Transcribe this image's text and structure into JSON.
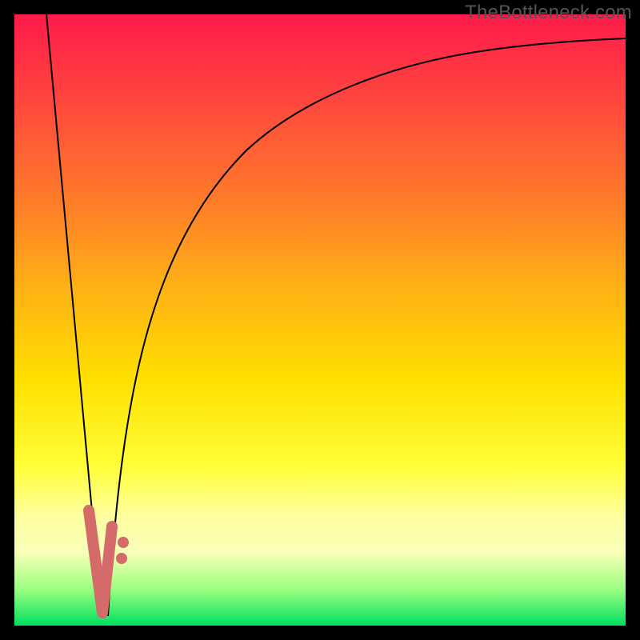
{
  "watermark": "TheBottleneck.com",
  "colors": {
    "dot": "#d46a6a",
    "curve": "#000000",
    "gradient_top": "#ff1a4a",
    "gradient_bottom": "#00e060"
  },
  "chart_data": {
    "type": "line",
    "title": "",
    "xlabel": "",
    "ylabel": "",
    "xlim": [
      0,
      100
    ],
    "ylim": [
      0,
      100
    ],
    "grid": false,
    "legend": false,
    "series": [
      {
        "name": "left-descending-line",
        "x": [
          5,
          14
        ],
        "y": [
          100,
          0
        ]
      },
      {
        "name": "right-rising-curve",
        "x": [
          15,
          17,
          20,
          24,
          30,
          38,
          48,
          60,
          75,
          90,
          100
        ],
        "y": [
          0,
          20,
          40,
          55,
          67,
          76,
          83,
          88,
          91,
          93,
          94
        ]
      }
    ],
    "markers": [
      {
        "name": "v-cluster-left-top",
        "x": 12.0,
        "y": 18
      },
      {
        "name": "v-cluster-left-mid",
        "x": 12.5,
        "y": 13
      },
      {
        "name": "v-cluster-left-low",
        "x": 13.0,
        "y": 8
      },
      {
        "name": "v-cluster-bottom-1",
        "x": 13.5,
        "y": 4
      },
      {
        "name": "v-cluster-bottom-2",
        "x": 14.0,
        "y": 2
      },
      {
        "name": "v-cluster-bottom-3",
        "x": 14.5,
        "y": 3
      },
      {
        "name": "v-cluster-right-low",
        "x": 15.0,
        "y": 6
      },
      {
        "name": "v-cluster-right-mid",
        "x": 15.3,
        "y": 10
      },
      {
        "name": "v-cluster-right-top",
        "x": 15.6,
        "y": 15
      },
      {
        "name": "outlier-dot-1",
        "x": 17.5,
        "y": 10
      },
      {
        "name": "outlier-dot-2",
        "x": 17.8,
        "y": 13
      }
    ]
  }
}
